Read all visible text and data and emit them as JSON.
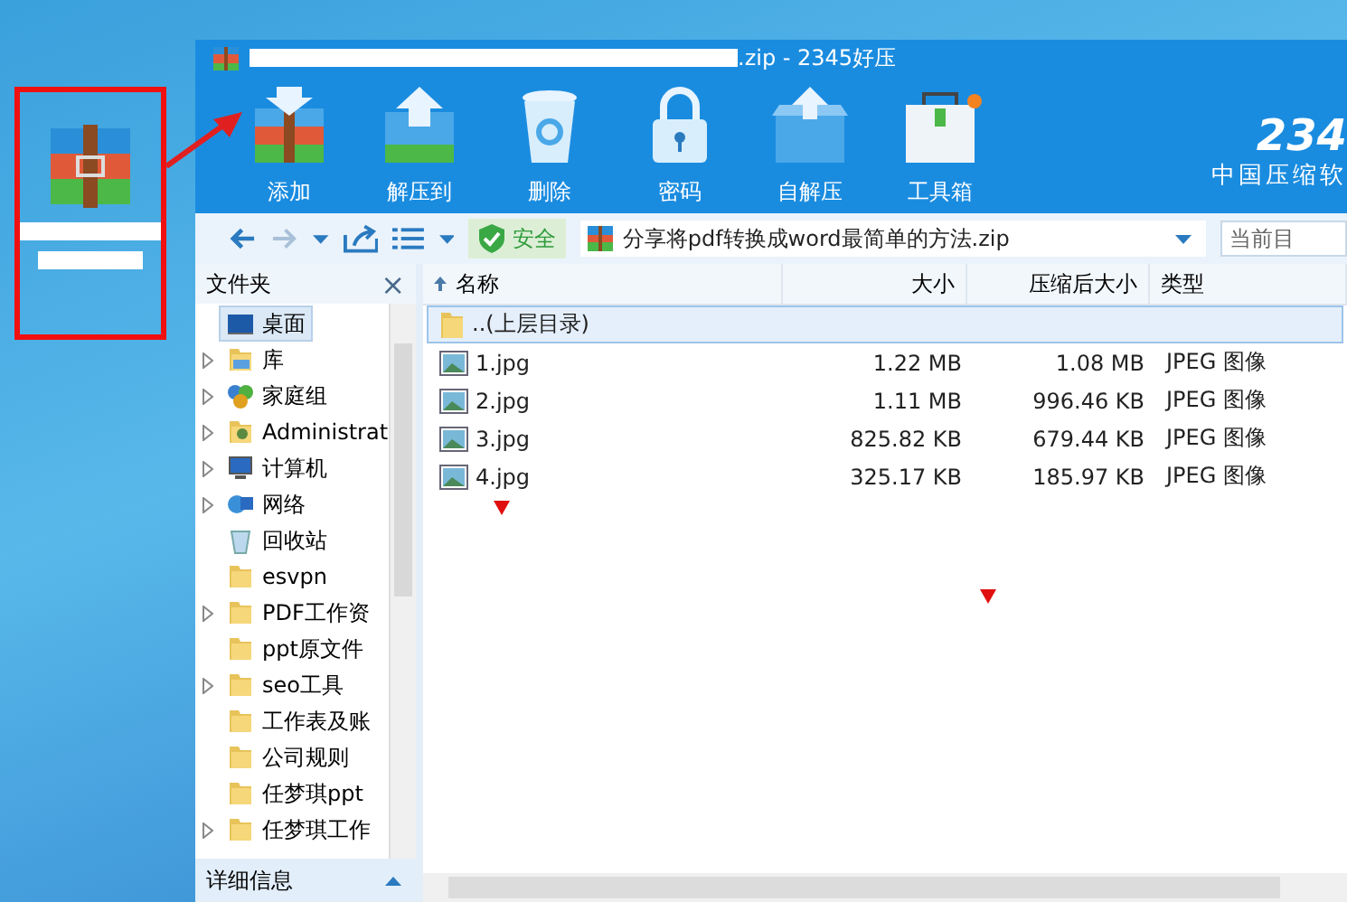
{
  "window": {
    "title": ".zip - 2345好压"
  },
  "toolbar": [
    {
      "label": "添加",
      "kind": "add"
    },
    {
      "label": "解压到",
      "kind": "extract"
    },
    {
      "label": "删除",
      "kind": "delete"
    },
    {
      "label": "密码",
      "kind": "password"
    },
    {
      "label": "自解压",
      "kind": "selfextract"
    },
    {
      "label": "工具箱",
      "kind": "toolbox"
    }
  ],
  "logo": {
    "mark": "234",
    "slogan": "中国压缩软"
  },
  "address_bar": {
    "safety": "安全",
    "path": "分享将pdf转换成word最简单的方法.zip",
    "search_placeholder": "当前目"
  },
  "folders_pane": {
    "title": "文件夹",
    "close": "×",
    "details": "详细信息"
  },
  "tree": [
    {
      "label": "桌面",
      "kind": "desktop",
      "expandable": false,
      "selected": true
    },
    {
      "label": "库",
      "kind": "library",
      "expandable": true,
      "selected": false
    },
    {
      "label": "家庭组",
      "kind": "homegroup",
      "expandable": true,
      "selected": false
    },
    {
      "label": "Administrat",
      "kind": "user",
      "expandable": true,
      "selected": false
    },
    {
      "label": "计算机",
      "kind": "computer",
      "expandable": true,
      "selected": false
    },
    {
      "label": "网络",
      "kind": "network",
      "expandable": true,
      "selected": false
    },
    {
      "label": "回收站",
      "kind": "recycle",
      "expandable": false,
      "selected": false
    },
    {
      "label": "esvpn",
      "kind": "folder",
      "expandable": false,
      "selected": false
    },
    {
      "label": "PDF工作资",
      "kind": "folder",
      "expandable": true,
      "selected": false
    },
    {
      "label": "ppt原文件",
      "kind": "folder",
      "expandable": false,
      "selected": false
    },
    {
      "label": "seo工具",
      "kind": "folder",
      "expandable": true,
      "selected": false
    },
    {
      "label": "工作表及账",
      "kind": "folder",
      "expandable": false,
      "selected": false
    },
    {
      "label": "公司规则",
      "kind": "folder",
      "expandable": false,
      "selected": false
    },
    {
      "label": "任梦琪ppt",
      "kind": "folder",
      "expandable": false,
      "selected": false
    },
    {
      "label": "任梦琪工作",
      "kind": "folder",
      "expandable": true,
      "selected": false
    }
  ],
  "table": {
    "columns": [
      "名称",
      "大小",
      "压缩后大小",
      "类型"
    ],
    "rows": [
      {
        "name": "..(上层目录)",
        "kind": "parent",
        "selected": true
      },
      {
        "name": "1.jpg",
        "kind": "image",
        "size": "1.22 MB",
        "packed": "1.08 MB",
        "type": "JPEG 图像",
        "selected": false
      },
      {
        "name": "2.jpg",
        "kind": "image",
        "size": "1.11 MB",
        "packed": "996.46 KB",
        "type": "JPEG 图像",
        "selected": false
      },
      {
        "name": "3.jpg",
        "kind": "image",
        "size": "825.82 KB",
        "packed": "679.44 KB",
        "type": "JPEG 图像",
        "selected": false
      },
      {
        "name": "4.jpg",
        "kind": "image",
        "size": "325.17 KB",
        "packed": "185.97 KB",
        "type": "JPEG 图像",
        "selected": false
      }
    ]
  }
}
